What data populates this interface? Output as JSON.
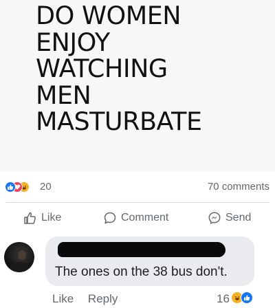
{
  "post": {
    "image_text_lines": [
      "DO WOMEN",
      "ENJOY",
      "WATCHING",
      "MEN",
      "MASTURBATE"
    ]
  },
  "reactions": {
    "icons": [
      "like-icon",
      "love-icon",
      "haha-icon"
    ],
    "count": "20",
    "comments": "70 comments"
  },
  "actions": {
    "like": "Like",
    "comment": "Comment",
    "send": "Send"
  },
  "comment": {
    "text": "The ones on the 38 bus don't.",
    "like": "Like",
    "reply": "Reply",
    "reaction_count": "16",
    "reaction_icons": [
      "haha-icon",
      "like-icon"
    ]
  },
  "colors": {
    "like_blue": "#1877f2",
    "love_red": "#f33e58",
    "haha_yellow": "#f7b125",
    "muted_text": "#65676b",
    "bubble": "#e9ebee"
  }
}
